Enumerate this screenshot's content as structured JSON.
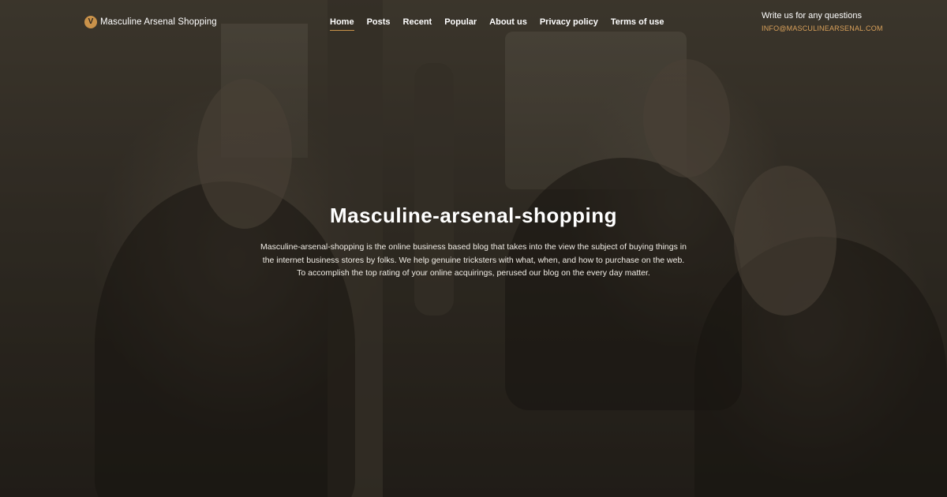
{
  "header": {
    "logo": {
      "icon": "v-shield-logo-icon",
      "mark": "V",
      "text": "Masculine Arsenal Shopping"
    },
    "nav": [
      {
        "label": "Home",
        "active": true
      },
      {
        "label": "Posts",
        "active": false
      },
      {
        "label": "Recent",
        "active": false
      },
      {
        "label": "Popular",
        "active": false
      },
      {
        "label": "About us",
        "active": false
      },
      {
        "label": "Privacy policy",
        "active": false
      },
      {
        "label": "Terms of use",
        "active": false
      }
    ],
    "contact": {
      "label": "Write us for any questions",
      "email": "INFO@MASCULINEARSENAL.COM"
    }
  },
  "hero": {
    "title": "Masculine-arsenal-shopping",
    "description": "Masculine-arsenal-shopping is the online business based blog that takes into the view the subject of buying things in the internet business stores by folks. We help genuine tricksters with what, when, and how to purchase on the web. To accomplish the top rating of your online acquirings, perused our blog on the every day matter."
  },
  "colors": {
    "accent": "#c9924a",
    "email": "#d9a15a",
    "background": "#2b2620"
  }
}
